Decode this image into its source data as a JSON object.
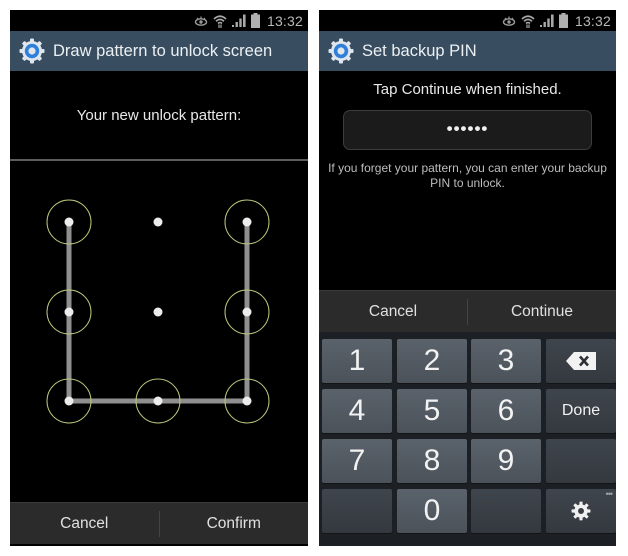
{
  "left_screen": {
    "status_bar": {
      "time": "13:32",
      "icons": [
        "eye-icon",
        "wifi-icon",
        "signal-icon",
        "battery-icon"
      ]
    },
    "title": "Draw pattern to unlock screen",
    "title_icon": "settings-gear-icon",
    "prompt": "Your new unlock pattern:",
    "pattern": {
      "grid_size": 3,
      "selected_dots": [
        1,
        4,
        7,
        8,
        9,
        6,
        3
      ],
      "dot_numbering": "row-major, 1 = top-left, 9 = bottom-right",
      "ring_color": "#b9c97a",
      "line_color": "#a8a8a8"
    },
    "buttons": {
      "cancel": "Cancel",
      "confirm": "Confirm"
    }
  },
  "right_screen": {
    "status_bar": {
      "time": "13:32",
      "icons": [
        "eye-icon",
        "wifi-icon",
        "signal-icon",
        "battery-icon"
      ]
    },
    "title": "Set backup PIN",
    "title_icon": "settings-gear-icon",
    "prompt": "Tap Continue when finished.",
    "pin_field": {
      "masked_value": "••••••"
    },
    "hint": "If you forget your pattern, you can enter your backup PIN to unlock.",
    "buttons": {
      "cancel": "Cancel",
      "continue": "Continue"
    },
    "keypad": {
      "keys": [
        {
          "label": "1",
          "type": "digit"
        },
        {
          "label": "2",
          "type": "digit"
        },
        {
          "label": "3",
          "type": "digit"
        },
        {
          "label": "",
          "type": "backspace",
          "icon": "backspace-icon"
        },
        {
          "label": "4",
          "type": "digit"
        },
        {
          "label": "5",
          "type": "digit"
        },
        {
          "label": "6",
          "type": "digit"
        },
        {
          "label": "Done",
          "type": "done"
        },
        {
          "label": "7",
          "type": "digit"
        },
        {
          "label": "8",
          "type": "digit"
        },
        {
          "label": "9",
          "type": "digit"
        },
        {
          "label": "",
          "type": "blank"
        },
        {
          "label": "",
          "type": "blank"
        },
        {
          "label": "0",
          "type": "digit"
        },
        {
          "label": "",
          "type": "blank"
        },
        {
          "label": "",
          "type": "settings",
          "icon": "keyboard-settings-icon",
          "more_indicator": "•••"
        }
      ]
    }
  },
  "colors": {
    "title_bar": "#384d60",
    "background": "#000000",
    "bottom_bar": "#2b2b2b",
    "key_light": "#555c65",
    "key_dark": "#3a3f45",
    "gear_blue": "#2f7fd8"
  }
}
